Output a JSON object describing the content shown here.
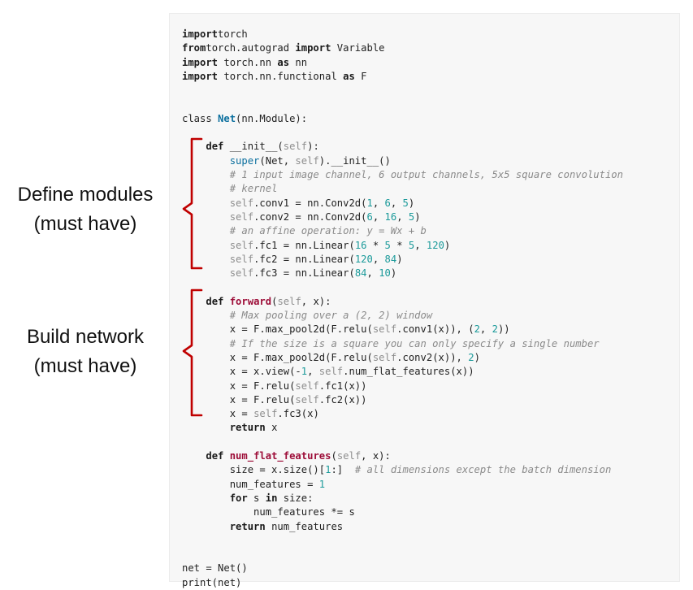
{
  "annotations": {
    "define_modules": {
      "line1": "Define modules",
      "line2": "(must have)"
    },
    "build_network": {
      "line1": "Build network",
      "line2": "(must have)"
    }
  },
  "colors": {
    "bracket": "#c00000",
    "keyword": "#1a1a1a",
    "builtin": "#0b6f9e",
    "self": "#8e8e8e",
    "number": "#1b9a9a",
    "function_name": "#9d0d38",
    "comment": "#8a8a8a"
  },
  "code": {
    "lines": [
      {
        "tokens": [
          [
            "kw",
            "import"
          ],
          [
            "",
            "torch"
          ]
        ]
      },
      {
        "tokens": [
          [
            "kw",
            "from"
          ],
          [
            "",
            "torch.autograd "
          ],
          [
            "kw",
            "import"
          ],
          [
            "",
            " Variable"
          ]
        ]
      },
      {
        "tokens": [
          [
            "kw",
            "import"
          ],
          [
            "",
            " torch.nn "
          ],
          [
            "kw",
            "as"
          ],
          [
            "",
            " nn"
          ]
        ]
      },
      {
        "tokens": [
          [
            "kw",
            "import"
          ],
          [
            "",
            " torch.nn.functional "
          ],
          [
            "kw",
            "as"
          ],
          [
            "",
            " F"
          ]
        ]
      },
      {
        "tokens": []
      },
      {
        "tokens": []
      },
      {
        "tokens": [
          [
            "",
            "class "
          ],
          [
            "cls",
            "Net"
          ],
          [
            "",
            "(nn.Module):"
          ]
        ]
      },
      {
        "tokens": []
      },
      {
        "tokens": [
          [
            "",
            "    "
          ],
          [
            "kw",
            "def"
          ],
          [
            "",
            " __init__("
          ],
          [
            "self",
            "self"
          ],
          [
            "",
            "):"
          ]
        ]
      },
      {
        "tokens": [
          [
            "",
            "        "
          ],
          [
            "builtin",
            "super"
          ],
          [
            "",
            "(Net, "
          ],
          [
            "self",
            "self"
          ],
          [
            "",
            ").__init__()"
          ]
        ]
      },
      {
        "tokens": [
          [
            "",
            "        "
          ],
          [
            "comment",
            "# 1 input image channel, 6 output channels, 5x5 square convolution"
          ]
        ]
      },
      {
        "tokens": [
          [
            "",
            "        "
          ],
          [
            "comment",
            "# kernel"
          ]
        ]
      },
      {
        "tokens": [
          [
            "",
            "        "
          ],
          [
            "self",
            "self"
          ],
          [
            "",
            ".conv1 = nn.Conv2d("
          ],
          [
            "num",
            "1"
          ],
          [
            "",
            ", "
          ],
          [
            "num",
            "6"
          ],
          [
            "",
            ", "
          ],
          [
            "num",
            "5"
          ],
          [
            "",
            ")"
          ]
        ]
      },
      {
        "tokens": [
          [
            "",
            "        "
          ],
          [
            "self",
            "self"
          ],
          [
            "",
            ".conv2 = nn.Conv2d("
          ],
          [
            "num",
            "6"
          ],
          [
            "",
            ", "
          ],
          [
            "num",
            "16"
          ],
          [
            "",
            ", "
          ],
          [
            "num",
            "5"
          ],
          [
            "",
            ")"
          ]
        ]
      },
      {
        "tokens": [
          [
            "",
            "        "
          ],
          [
            "comment",
            "# an affine operation: y = Wx + b"
          ]
        ]
      },
      {
        "tokens": [
          [
            "",
            "        "
          ],
          [
            "self",
            "self"
          ],
          [
            "",
            ".fc1 = nn.Linear("
          ],
          [
            "num",
            "16"
          ],
          [
            "",
            " * "
          ],
          [
            "num",
            "5"
          ],
          [
            "",
            " * "
          ],
          [
            "num",
            "5"
          ],
          [
            "",
            ", "
          ],
          [
            "num",
            "120"
          ],
          [
            "",
            ")"
          ]
        ]
      },
      {
        "tokens": [
          [
            "",
            "        "
          ],
          [
            "self",
            "self"
          ],
          [
            "",
            ".fc2 = nn.Linear("
          ],
          [
            "num",
            "120"
          ],
          [
            "",
            ", "
          ],
          [
            "num",
            "84"
          ],
          [
            "",
            ")"
          ]
        ]
      },
      {
        "tokens": [
          [
            "",
            "        "
          ],
          [
            "self",
            "self"
          ],
          [
            "",
            ".fc3 = nn.Linear("
          ],
          [
            "num",
            "84"
          ],
          [
            "",
            ", "
          ],
          [
            "num",
            "10"
          ],
          [
            "",
            ")"
          ]
        ]
      },
      {
        "tokens": []
      },
      {
        "tokens": [
          [
            "",
            "    "
          ],
          [
            "kw",
            "def"
          ],
          [
            "",
            " "
          ],
          [
            "fn",
            "forward"
          ],
          [
            "",
            "("
          ],
          [
            "self",
            "self"
          ],
          [
            "",
            ", x):"
          ]
        ]
      },
      {
        "tokens": [
          [
            "",
            "        "
          ],
          [
            "comment",
            "# Max pooling over a (2, 2) window"
          ]
        ]
      },
      {
        "tokens": [
          [
            "",
            "        x = F.max_pool2d(F.relu("
          ],
          [
            "self",
            "self"
          ],
          [
            "",
            ".conv1(x)), ("
          ],
          [
            "num",
            "2"
          ],
          [
            "",
            ", "
          ],
          [
            "num",
            "2"
          ],
          [
            "",
            "))"
          ]
        ]
      },
      {
        "tokens": [
          [
            "",
            "        "
          ],
          [
            "comment",
            "# If the size is a square you can only specify a single number"
          ]
        ]
      },
      {
        "tokens": [
          [
            "",
            "        x = F.max_pool2d(F.relu("
          ],
          [
            "self",
            "self"
          ],
          [
            "",
            ".conv2(x)), "
          ],
          [
            "num",
            "2"
          ],
          [
            "",
            ")"
          ]
        ]
      },
      {
        "tokens": [
          [
            "",
            "        x = x.view(-"
          ],
          [
            "num",
            "1"
          ],
          [
            "",
            ", "
          ],
          [
            "self",
            "self"
          ],
          [
            "",
            ".num_flat_features(x))"
          ]
        ]
      },
      {
        "tokens": [
          [
            "",
            "        x = F.relu("
          ],
          [
            "self",
            "self"
          ],
          [
            "",
            ".fc1(x))"
          ]
        ]
      },
      {
        "tokens": [
          [
            "",
            "        x = F.relu("
          ],
          [
            "self",
            "self"
          ],
          [
            "",
            ".fc2(x))"
          ]
        ]
      },
      {
        "tokens": [
          [
            "",
            "        x = "
          ],
          [
            "self",
            "self"
          ],
          [
            "",
            ".fc3(x)"
          ]
        ]
      },
      {
        "tokens": [
          [
            "",
            "        "
          ],
          [
            "kw",
            "return"
          ],
          [
            "",
            " x"
          ]
        ]
      },
      {
        "tokens": []
      },
      {
        "tokens": [
          [
            "",
            "    "
          ],
          [
            "kw",
            "def"
          ],
          [
            "",
            " "
          ],
          [
            "fn",
            "num_flat_features"
          ],
          [
            "",
            "("
          ],
          [
            "self",
            "self"
          ],
          [
            "",
            ", x):"
          ]
        ]
      },
      {
        "tokens": [
          [
            "",
            "        size = x.size()["
          ],
          [
            "num",
            "1"
          ],
          [
            "",
            ":]  "
          ],
          [
            "comment",
            "# all dimensions except the batch dimension"
          ]
        ]
      },
      {
        "tokens": [
          [
            "",
            "        num_features = "
          ],
          [
            "num",
            "1"
          ]
        ]
      },
      {
        "tokens": [
          [
            "",
            "        "
          ],
          [
            "kw",
            "for"
          ],
          [
            "",
            " s "
          ],
          [
            "kw",
            "in"
          ],
          [
            "",
            " size:"
          ]
        ]
      },
      {
        "tokens": [
          [
            "",
            "            num_features *= s"
          ]
        ]
      },
      {
        "tokens": [
          [
            "",
            "        "
          ],
          [
            "kw",
            "return"
          ],
          [
            "",
            " num_features"
          ]
        ]
      },
      {
        "tokens": []
      },
      {
        "tokens": []
      },
      {
        "tokens": [
          [
            "",
            "net = Net()"
          ]
        ]
      },
      {
        "tokens": [
          [
            "",
            "print(net)"
          ]
        ]
      }
    ]
  }
}
